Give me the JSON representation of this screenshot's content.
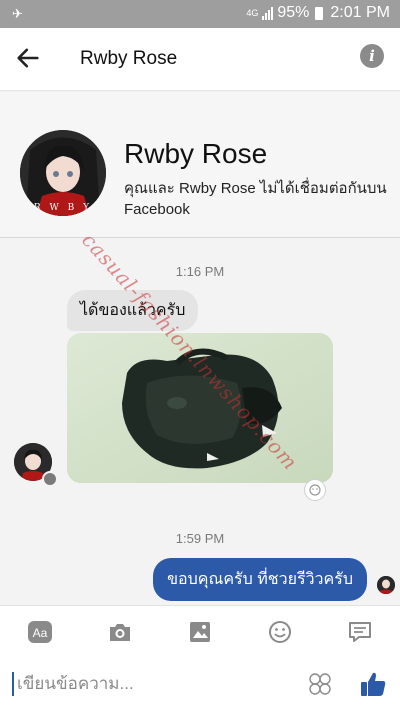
{
  "status_bar": {
    "network": "4G",
    "signal_label": "LTE",
    "battery": "95%",
    "time": "2:01 PM"
  },
  "header": {
    "title": "Rwby Rose"
  },
  "profile": {
    "name": "Rwby Rose",
    "subtitle": "คุณและ Rwby Rose ไม่ได้เชื่อมต่อกันบน Facebook",
    "avatar_text": "R W B Y"
  },
  "chat": {
    "timestamp_1": "1:16 PM",
    "incoming_message": "ได้ของแล้วครับ",
    "timestamp_2": "1:59 PM",
    "outgoing_message": "ขอบคุณครับ ที่ชวยรีวิวครับ"
  },
  "watermark": "casual-fashion.lnwshop.com",
  "composer": {
    "placeholder": "เขียนข้อความ..."
  },
  "toolbar": {
    "text_button": "Aa"
  },
  "colors": {
    "accent": "#2c5aa8",
    "bubble_in": "#e4e4e4",
    "status_bar": "#9e9e9e"
  }
}
